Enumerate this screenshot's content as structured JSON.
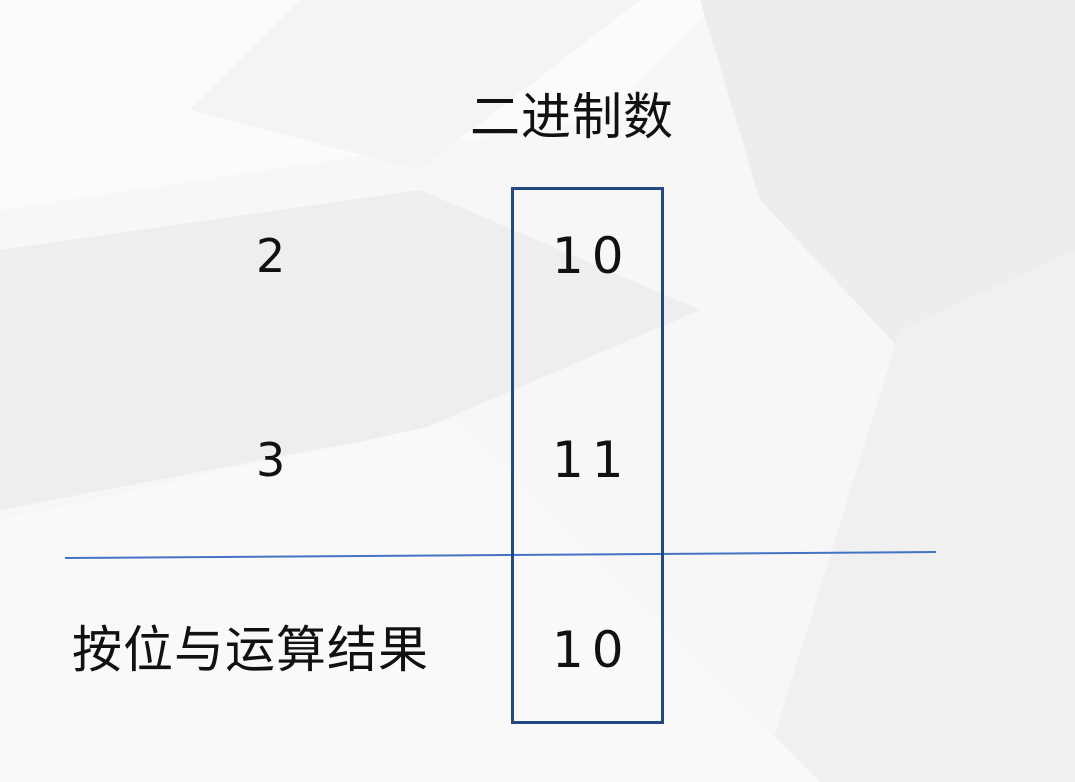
{
  "slide": {
    "title": "二进制数",
    "rows": [
      {
        "label": "2",
        "binary": "10"
      },
      {
        "label": "3",
        "binary": "11"
      }
    ],
    "result": {
      "label": "按位与运算结果",
      "binary": "10"
    }
  },
  "colors": {
    "accent_line": "#4473c5",
    "box_border": "#24497f",
    "background": "#f7f7f8"
  }
}
